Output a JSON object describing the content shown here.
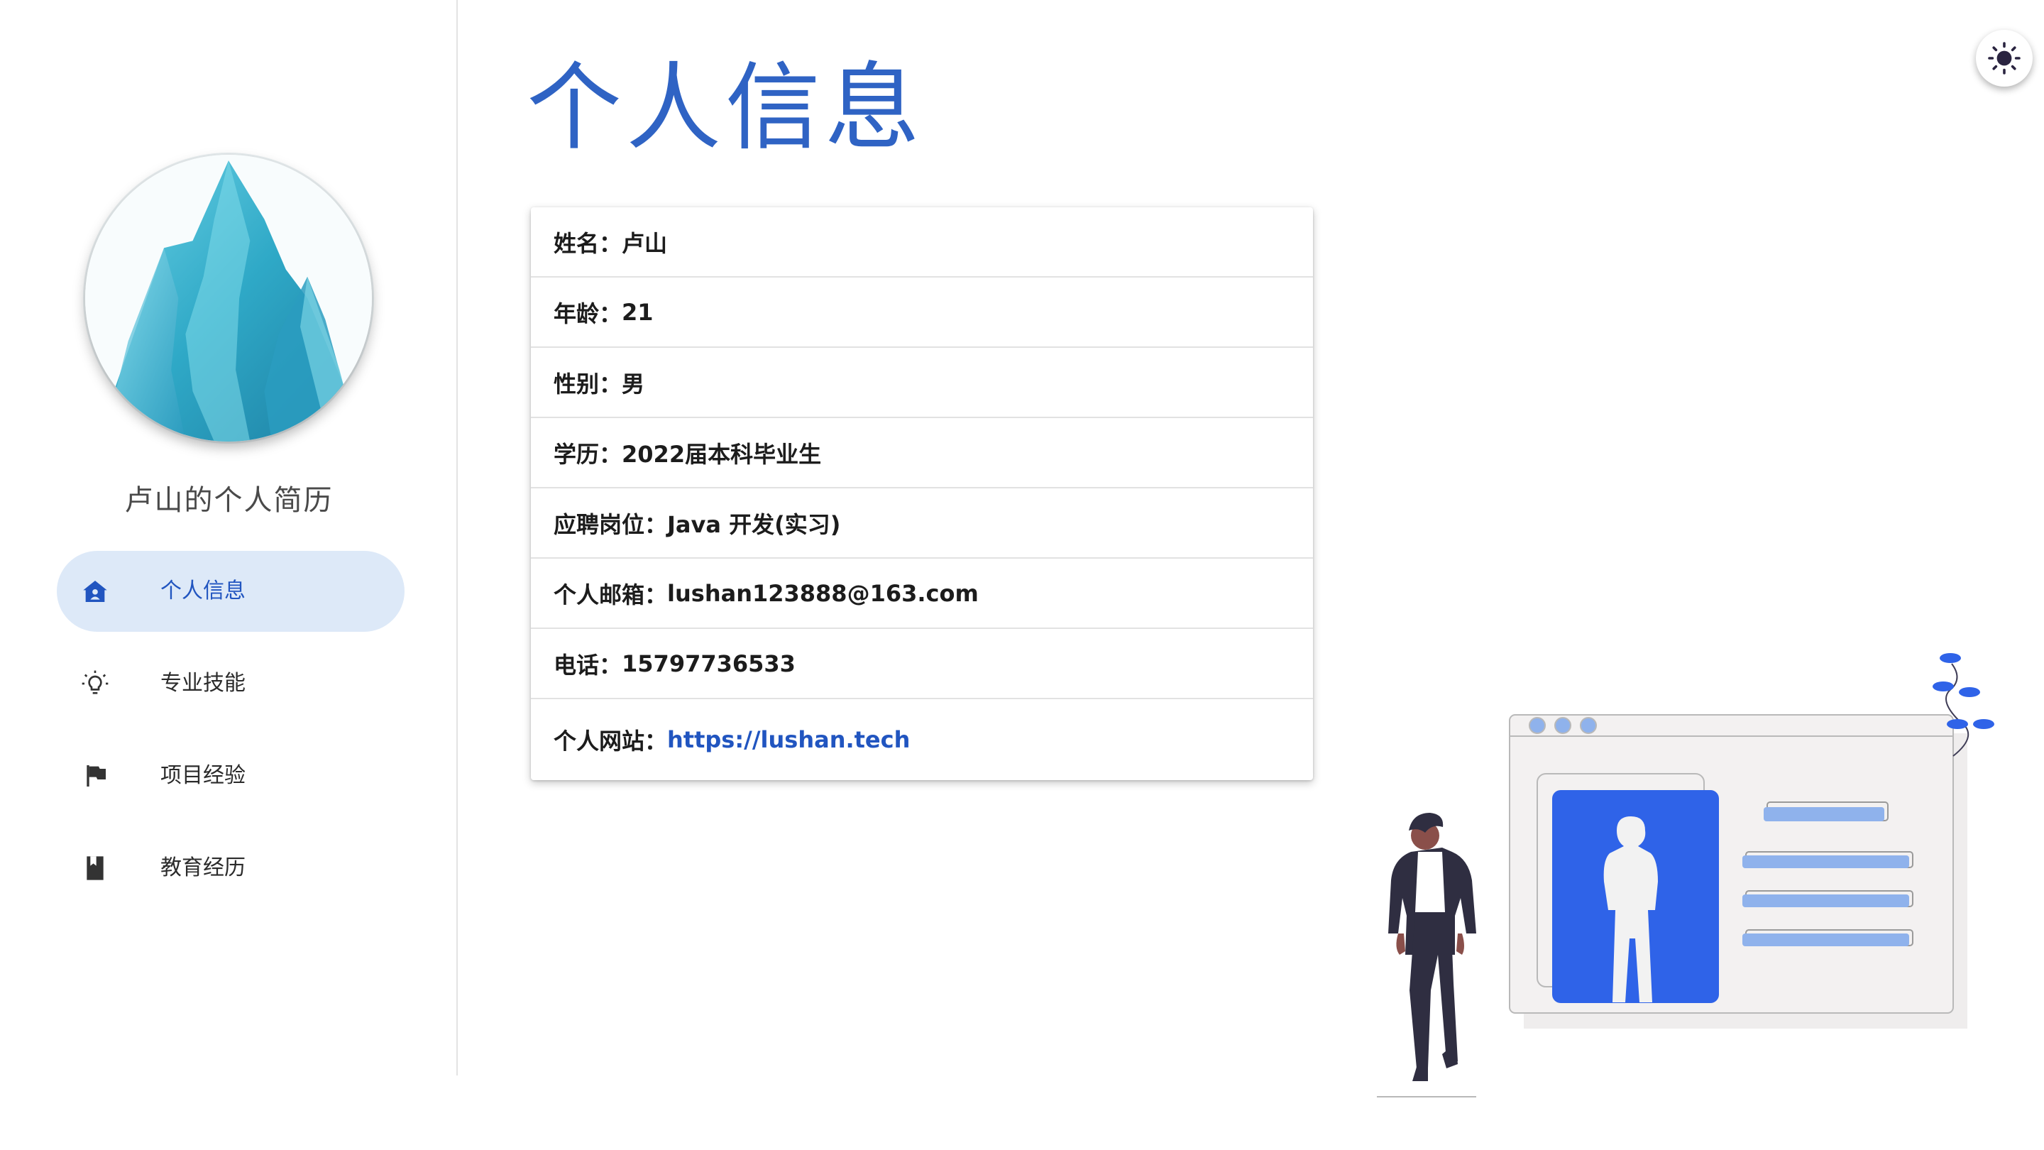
{
  "sidebar": {
    "title": "卢山的个人简历",
    "avatar_icon": "mountain-avatar",
    "items": [
      {
        "label": "个人信息",
        "icon": "home-icon",
        "active": true
      },
      {
        "label": "专业技能",
        "icon": "lightbulb-icon",
        "active": false
      },
      {
        "label": "项目经验",
        "icon": "flag-icon",
        "active": false
      },
      {
        "label": "教育经历",
        "icon": "book-icon",
        "active": false
      }
    ]
  },
  "main": {
    "title": "个人信息",
    "info": [
      {
        "label": "姓名：",
        "value": "卢山"
      },
      {
        "label": "年龄：",
        "value": "21"
      },
      {
        "label": "性别：",
        "value": "男"
      },
      {
        "label": "学历：",
        "value": "2022届本科毕业生"
      },
      {
        "label": "应聘岗位：",
        "value": "Java 开发(实习)"
      },
      {
        "label": "个人邮箱：",
        "value": "lushan123888@163.com"
      },
      {
        "label": "电话：",
        "value": "15797736533"
      },
      {
        "label": "个人网站：",
        "value": "https://lushan.tech"
      }
    ]
  },
  "theme_toggle": {
    "icon": "sun-icon"
  },
  "colors": {
    "accent": "#2f63c4",
    "link": "#2155c0",
    "active_nav_bg": "#dde9f8",
    "illustration_blue": "#2f63e8"
  }
}
